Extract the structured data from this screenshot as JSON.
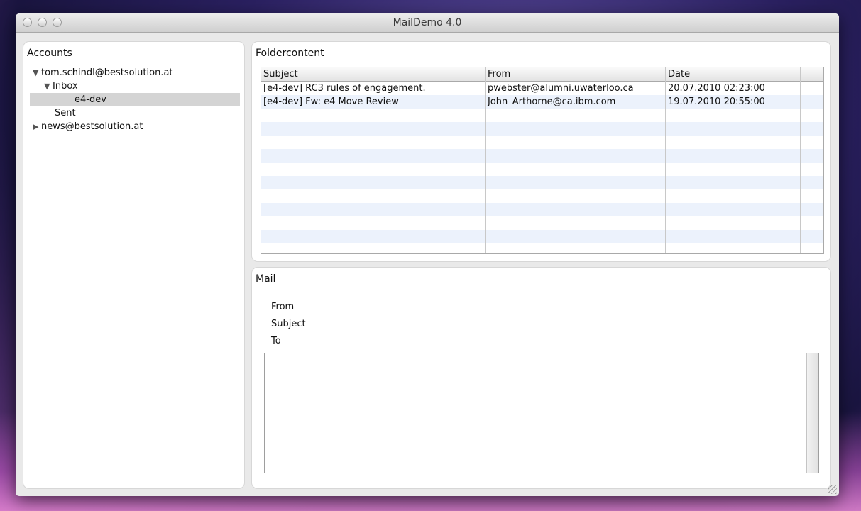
{
  "window": {
    "title": "MailDemo 4.0"
  },
  "accounts": {
    "title": "Accounts",
    "items": [
      {
        "label": "tom.schindl@bestsolution.at",
        "expanded": true
      },
      {
        "label": "Inbox",
        "expanded": true
      },
      {
        "label": "e4-dev",
        "selected": true
      },
      {
        "label": "Sent"
      },
      {
        "label": "news@bestsolution.at",
        "expanded": false
      }
    ]
  },
  "foldercontent": {
    "title": "Foldercontent",
    "columns": [
      "Subject",
      "From",
      "Date"
    ],
    "rows": [
      {
        "subject": "[e4-dev] RC3 rules of engagement.",
        "from": "pwebster@alumni.uwaterloo.ca",
        "date": "20.07.2010 02:23:00"
      },
      {
        "subject": "[e4-dev] Fw: e4 Move Review",
        "from": "John_Arthorne@ca.ibm.com",
        "date": "19.07.2010 20:55:00"
      }
    ]
  },
  "mail": {
    "title": "Mail",
    "from_label": "From",
    "subject_label": "Subject",
    "to_label": "To",
    "body": ""
  },
  "colors": {
    "alt_row": "#ecf2fc",
    "selected": "#d4d4d4"
  }
}
